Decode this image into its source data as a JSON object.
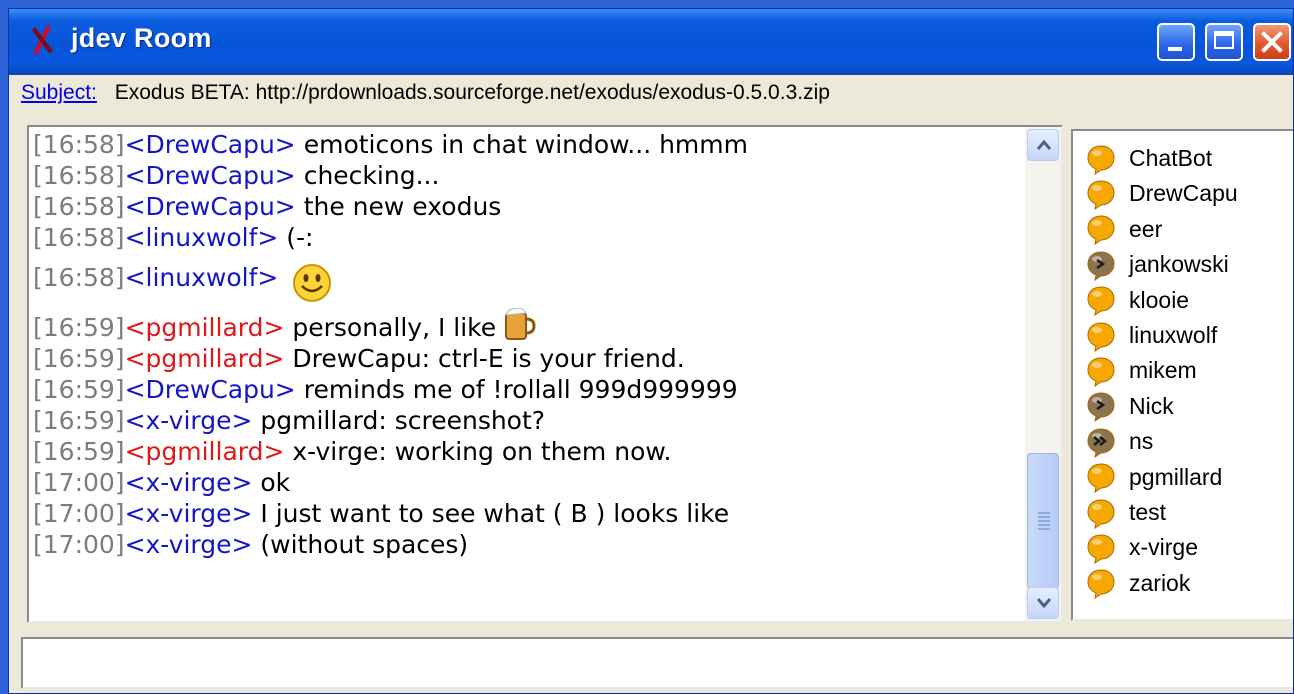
{
  "window": {
    "title": "jdev Room",
    "accent": "#0754d8"
  },
  "subject": {
    "label": "Subject:",
    "text": "Exodus BETA: http://prdownloads.sourceforge.net/exodus/exodus-0.5.0.3.zip"
  },
  "messages": [
    {
      "time": "[16:58]",
      "nick": "<DrewCapu>",
      "text": " emoticons in chat window... hmmm"
    },
    {
      "time": "[16:58]",
      "nick": "<DrewCapu>",
      "text": " checking..."
    },
    {
      "time": "[16:58]",
      "nick": "<DrewCapu>",
      "text": " the new exodus"
    },
    {
      "time": "[16:58]",
      "nick": "<linuxwolf>",
      "text": " (-:"
    },
    {
      "time": "[16:58]",
      "nick": "<linuxwolf>",
      "text": " ",
      "emoticon": "smiley-icon"
    },
    {
      "time": "[16:59]",
      "nick": "<pgmillard>",
      "text": " personally, I like",
      "emoticon": "beer-mug-icon"
    },
    {
      "time": "[16:59]",
      "nick": "<pgmillard>",
      "text": " DrewCapu: ctrl-E is your friend."
    },
    {
      "time": "[16:59]",
      "nick": "<DrewCapu>",
      "text": " reminds me of !rollall 999d999999"
    },
    {
      "time": "[16:59]",
      "nick": "<x-virge>",
      "text": " pgmillard: screenshot?"
    },
    {
      "time": "[16:59]",
      "nick": "<pgmillard>",
      "text": " x-virge: working on them now."
    },
    {
      "time": "[17:00]",
      "nick": "<x-virge>",
      "text": " ok"
    },
    {
      "time": "[17:00]",
      "nick": "<x-virge>",
      "text": " I just want to see what ( B ) looks like"
    },
    {
      "time": "[17:00]",
      "nick": "<x-virge>",
      "text": " (without spaces)"
    }
  ],
  "roster": [
    {
      "name": "ChatBot",
      "status": "available"
    },
    {
      "name": "DrewCapu",
      "status": "available"
    },
    {
      "name": "eer",
      "status": "available"
    },
    {
      "name": "jankowski",
      "status": "away"
    },
    {
      "name": "klooie",
      "status": "available"
    },
    {
      "name": "linuxwolf",
      "status": "available"
    },
    {
      "name": "mikem",
      "status": "available"
    },
    {
      "name": "Nick",
      "status": "away"
    },
    {
      "name": "ns",
      "status": "extended-away"
    },
    {
      "name": "pgmillard",
      "status": "available"
    },
    {
      "name": "test",
      "status": "available"
    },
    {
      "name": "x-virge",
      "status": "available"
    },
    {
      "name": "zariok",
      "status": "available"
    }
  ],
  "colors": {
    "timestamp": "#7d7d7d",
    "nick_self": "#e01818",
    "nick_other": "#1515c8",
    "available": "#f5a000",
    "away": "#8a7a5a"
  },
  "input": {
    "value": ""
  }
}
